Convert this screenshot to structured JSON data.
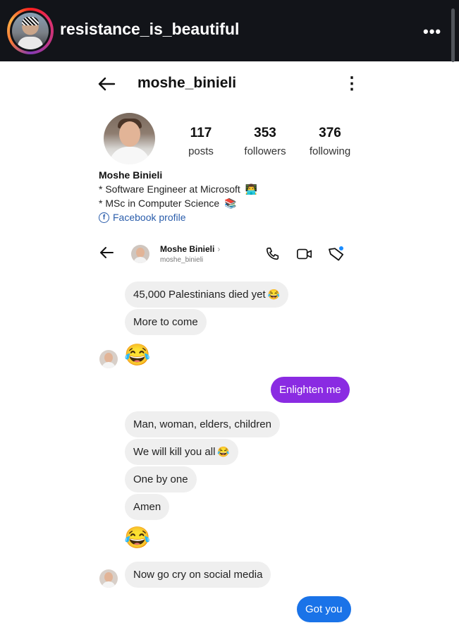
{
  "story": {
    "username": "resistance_is_beautiful",
    "more_icon": "•••"
  },
  "profile": {
    "back_icon": "arrow-left",
    "username": "moshe_binieli",
    "kebab": "⋮",
    "stats": {
      "posts": {
        "value": "117",
        "label": "posts"
      },
      "followers": {
        "value": "353",
        "label": "followers"
      },
      "following": {
        "value": "376",
        "label": "following"
      }
    },
    "bio": {
      "name": "Moshe Binieli",
      "line1": "* Software Engineer at Microsoft",
      "line1_emoji": "👨‍💻",
      "line2": "* MSc in Computer Science",
      "line2_emoji": "📚",
      "link": "Facebook profile"
    }
  },
  "chat": {
    "name": "Moshe Binieli",
    "handle": "moshe_binieli",
    "chevron": "›",
    "icons": [
      "phone-icon",
      "video-icon",
      "tag-icon"
    ],
    "messages": [
      {
        "from": "them",
        "text": "45,000 Palestinians died yet",
        "emoji": "😂"
      },
      {
        "from": "them",
        "text": "More to come"
      },
      {
        "from": "them",
        "emoji_only": "😂"
      },
      {
        "from": "me",
        "text": "Enlighten me"
      },
      {
        "from": "them",
        "text": "Man, woman, elders, children"
      },
      {
        "from": "them",
        "text": "We will kill you all",
        "emoji": "😂"
      },
      {
        "from": "them",
        "text": "One by one"
      },
      {
        "from": "them",
        "text": "Amen"
      },
      {
        "from": "them",
        "emoji_only": "😂"
      },
      {
        "from": "them",
        "text": "Now go cry on social media"
      },
      {
        "from": "me",
        "text": "Got you"
      }
    ]
  },
  "colors": {
    "story_bar": "#121419",
    "outgoing_purple": "#8a2be2",
    "outgoing_blue": "#1a73e8",
    "incoming": "#efefef",
    "link": "#2a5dab"
  }
}
